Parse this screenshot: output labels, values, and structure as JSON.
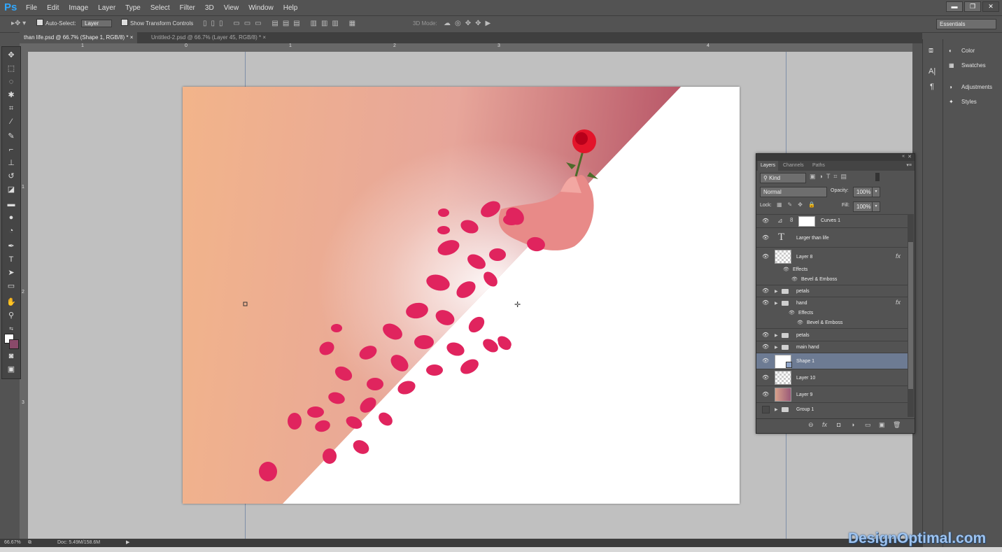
{
  "app": {
    "logo": "Ps"
  },
  "menu": [
    "File",
    "Edit",
    "Image",
    "Layer",
    "Type",
    "Select",
    "Filter",
    "3D",
    "View",
    "Window",
    "Help"
  ],
  "window_controls": {
    "minimize": "▬",
    "restore": "❐",
    "close": "✕"
  },
  "options": {
    "auto_select_label": "Auto-Select:",
    "auto_select_value": "Layer",
    "show_transform_label": "Show Transform Controls",
    "mode_3d_label": "3D Mode:",
    "workspace": "Essentials"
  },
  "tabs": [
    {
      "label": "than life.psd @ 66.7% (Shape 1, RGB/8) *",
      "close": "×"
    },
    {
      "label": "Untitled-2.psd @ 66.7% (Layer 45, RGB/8) *",
      "close": "×"
    }
  ],
  "ruler": {
    "top": [
      "1",
      "0",
      "1",
      "2",
      "3",
      "4"
    ],
    "left": [
      "1",
      "2",
      "3"
    ]
  },
  "status": {
    "zoom": "66.67%",
    "doc": "Doc: 5.49M/158.6M",
    "arrow": "▶"
  },
  "dock": [
    {
      "icon": "color-icon",
      "label": "Color"
    },
    {
      "icon": "swatches-icon",
      "label": "Swatches"
    },
    {
      "icon": "adjustments-icon",
      "label": "Adjustments"
    },
    {
      "icon": "styles-icon",
      "label": "Styles"
    }
  ],
  "layers_panel": {
    "tabs": [
      "Layers",
      "Channels",
      "Paths"
    ],
    "filter": "Kind",
    "blend_mode": "Normal",
    "opacity_label": "Opacity:",
    "opacity_value": "100%",
    "lock_label": "Lock:",
    "fill_label": "Fill:",
    "fill_value": "100%",
    "layers": {
      "curves": "Curves 1",
      "text": "Larger than life",
      "layer8": "Layer 8",
      "effects1": "Effects",
      "bevel1": "Bevel & Emboss",
      "petals1": "petals",
      "hand": "hand",
      "effects2": "Effects",
      "bevel2": "Bevel & Emboss",
      "petals2": "petals",
      "main_hand": "main hand",
      "shape1": "Shape 1",
      "layer10": "Layer 10",
      "layer9": "Layer 9",
      "group1": "Group 1"
    },
    "fx_label": "fx",
    "footer": [
      "⊖",
      "fx",
      "◘",
      "◑",
      "▭",
      "▣",
      "🗑"
    ]
  },
  "watermark": "DesignOptimal.com",
  "colors": {
    "canvas_gradient_start": "#f2b48a",
    "canvas_gradient_end": "#c4707f",
    "petal": "#e0245e",
    "selected_layer": "#6d7b93"
  }
}
